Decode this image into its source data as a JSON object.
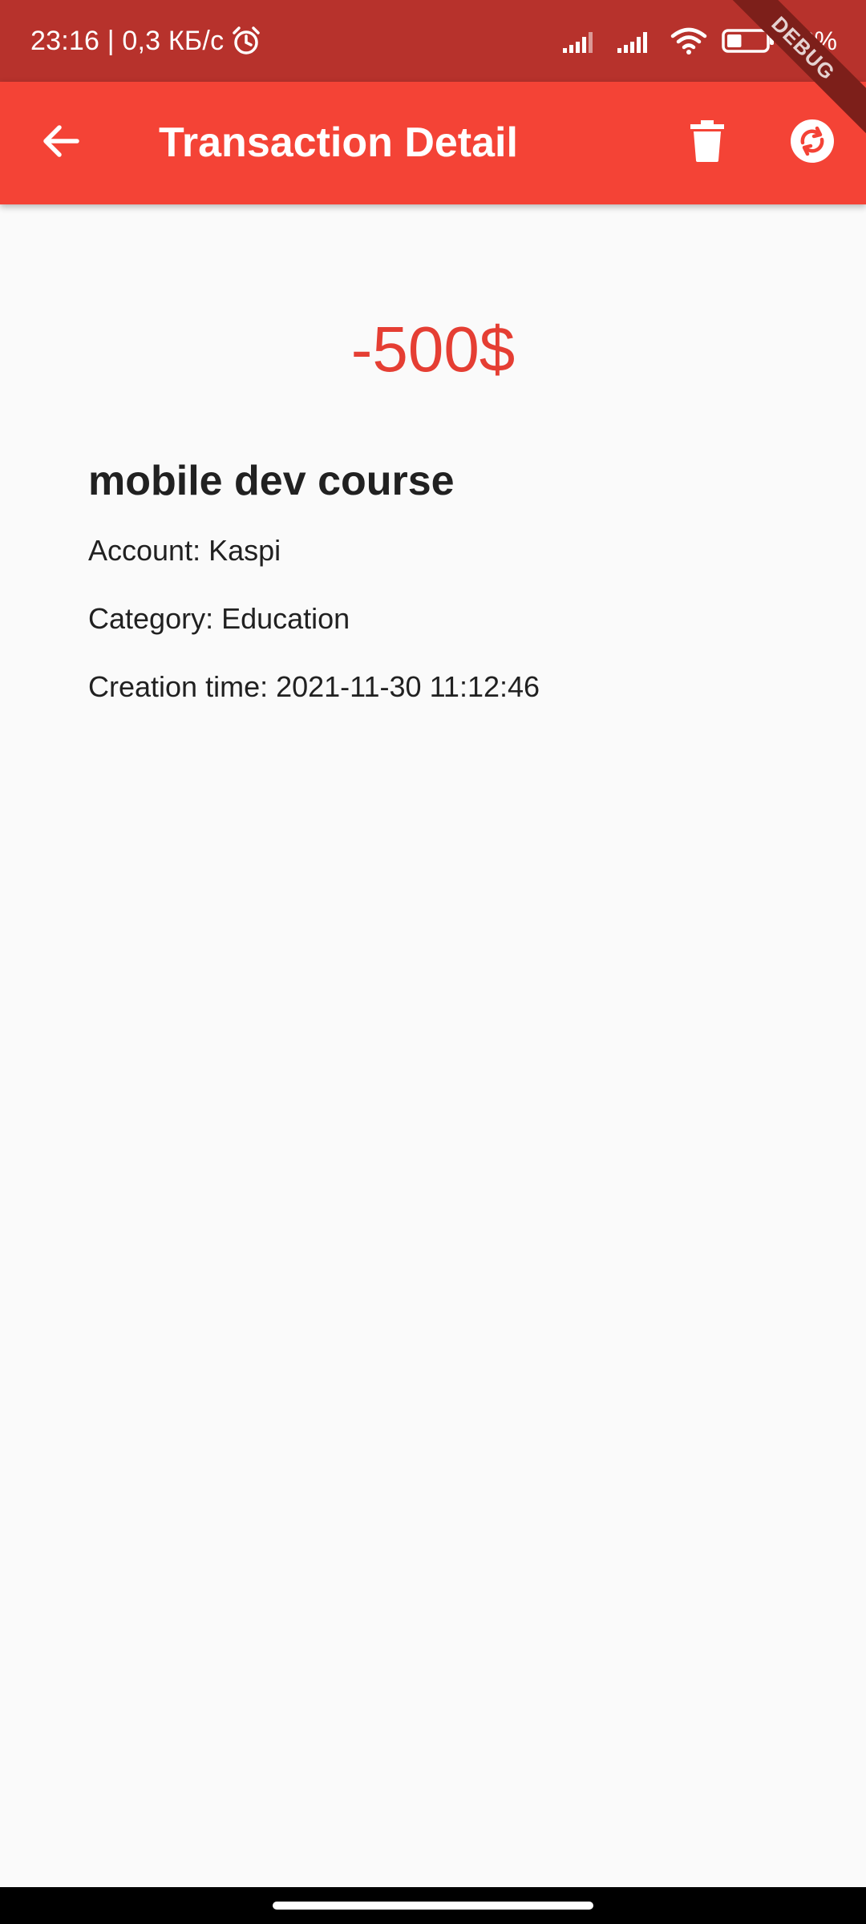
{
  "status_bar": {
    "time_speed": "23:16 | 0,3 КБ/с",
    "battery_percent": "38%",
    "battery_level": 0.38,
    "icons": [
      "alarm-icon",
      "signal-icon",
      "signal-icon",
      "wifi-icon",
      "battery-icon"
    ]
  },
  "debug_banner": "DEBUG",
  "app_bar": {
    "title": "Transaction Detail",
    "back_icon": "arrow-back-icon",
    "delete_icon": "trash-icon",
    "sync_icon": "sync-icon",
    "color": "#f44336"
  },
  "transaction": {
    "amount": "-500$",
    "amount_color": "#e53e33",
    "title": "mobile dev course",
    "account": "Account: Kaspi",
    "category": "Category: Education",
    "creation_time": "Creation time: 2021-11-30 11:12:46"
  }
}
